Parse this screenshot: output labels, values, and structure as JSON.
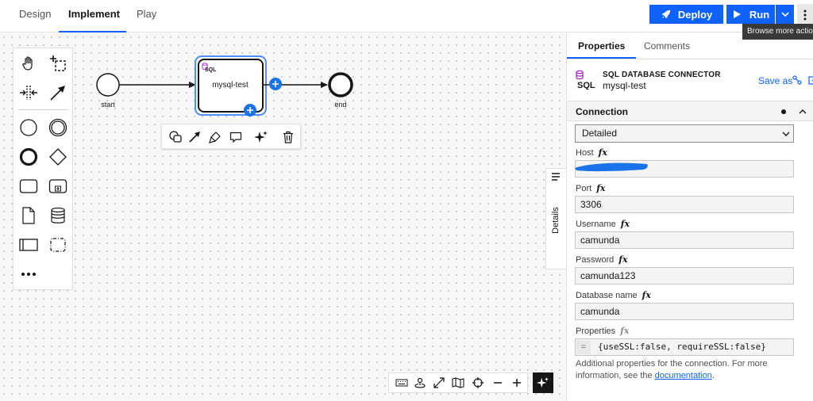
{
  "tabs": [
    {
      "label": "Design"
    },
    {
      "label": "Implement"
    },
    {
      "label": "Play"
    }
  ],
  "actions": {
    "deploy_label": "Deploy",
    "run_label": "Run",
    "tooltip": "Browse more actions"
  },
  "diagram": {
    "start_label": "start",
    "task_label": "mysql-test",
    "task_icon_text": "SQL",
    "end_label": "end"
  },
  "details_tab_label": "Details",
  "panel": {
    "tabs": [
      {
        "label": "Properties"
      },
      {
        "label": "Comments"
      }
    ],
    "element_type": "SQL DATABASE CONNECTOR",
    "element_name": "mysql-test",
    "save_as_label": "Save as",
    "group_title": "Connection",
    "connection_mode": "Detailed",
    "fields": {
      "host": {
        "label": "Host",
        "value": ""
      },
      "port": {
        "label": "Port",
        "value": "3306"
      },
      "username": {
        "label": "Username",
        "value": "camunda"
      },
      "password": {
        "label": "Password",
        "value": "camunda123"
      },
      "database": {
        "label": "Database name",
        "value": "camunda"
      },
      "properties": {
        "label": "Properties",
        "value": "{useSSL:false, requireSSL:false}",
        "prefix": "="
      }
    },
    "fx_symbol": "fx",
    "help": {
      "text": "Additional properties for the connection. For more information, see the ",
      "link": "documentation",
      "suffix": "."
    }
  },
  "colors": {
    "accent": "#0f62fe",
    "redaction": "#1a73e8",
    "sql_icon": "#a020c8"
  }
}
